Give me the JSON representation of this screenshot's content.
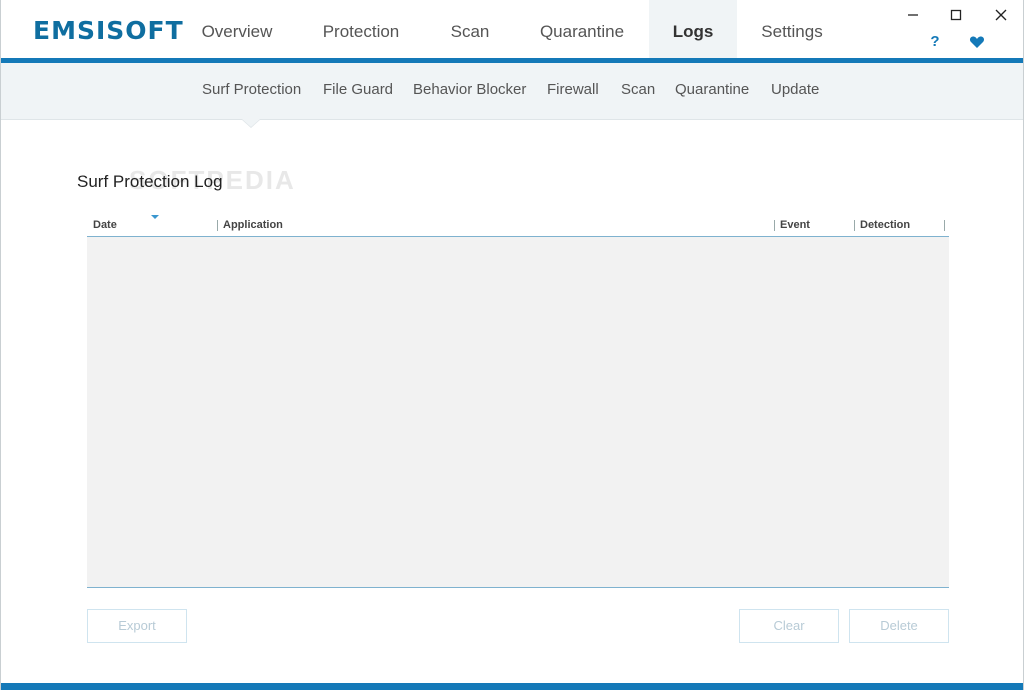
{
  "app": {
    "logo": "EMSISOFT"
  },
  "nav": {
    "tabs": [
      {
        "label": "Overview"
      },
      {
        "label": "Protection"
      },
      {
        "label": "Scan"
      },
      {
        "label": "Quarantine"
      },
      {
        "label": "Logs",
        "active": true
      },
      {
        "label": "Settings"
      }
    ]
  },
  "window": {
    "minimize": "—",
    "maximize": "☐",
    "close": "✕",
    "help": "?"
  },
  "subnav": {
    "items": [
      {
        "label": "Surf Protection",
        "active": true
      },
      {
        "label": "File Guard"
      },
      {
        "label": "Behavior Blocker"
      },
      {
        "label": "Firewall"
      },
      {
        "label": "Scan"
      },
      {
        "label": "Quarantine"
      },
      {
        "label": "Update"
      }
    ]
  },
  "page": {
    "title": "Surf Protection Log",
    "watermark": "SOFTPEDIA"
  },
  "table": {
    "columns": [
      "Date",
      "Application",
      "Event",
      "Detection"
    ],
    "sort_column": "Date",
    "rows": []
  },
  "buttons": {
    "export": "Export",
    "clear": "Clear",
    "delete": "Delete"
  },
  "colors": {
    "accent": "#1479b8",
    "subnav_bg": "#f0f4f6",
    "table_bg": "#f2f2f2"
  },
  "icons": {
    "favorite": "heart-icon",
    "help": "question-icon"
  }
}
